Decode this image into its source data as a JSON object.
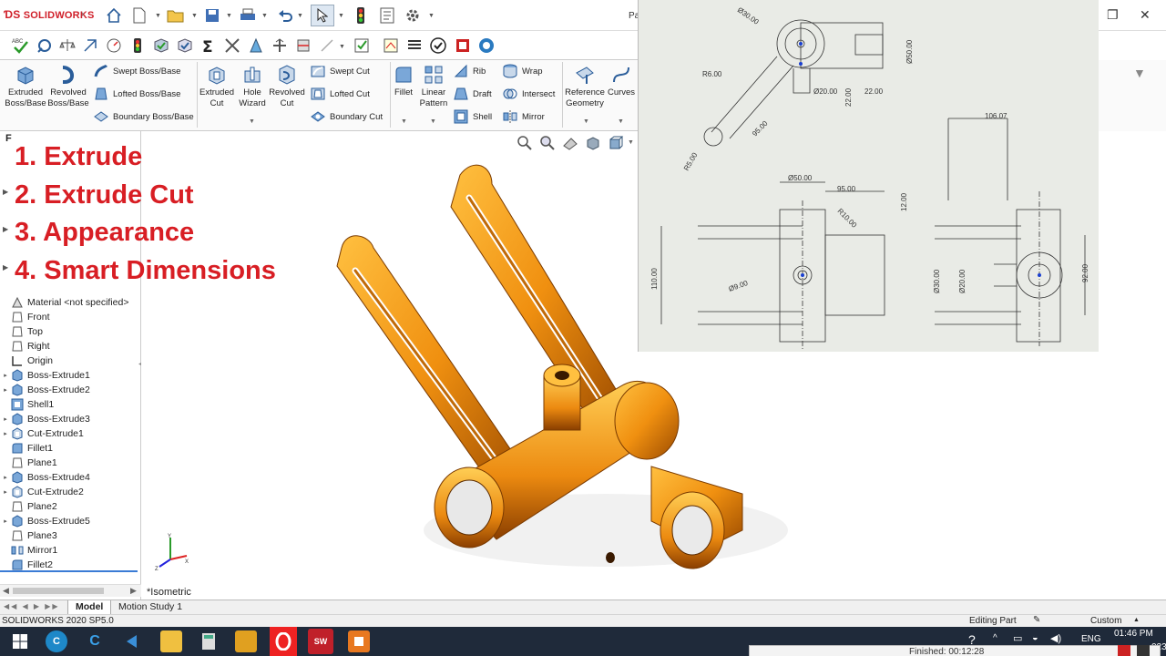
{
  "app": {
    "brand": "SOLIDWORKS",
    "doc_title_partial": "Pa",
    "version_status": "SOLIDWORKS 2020 SP5.0"
  },
  "ribbon": {
    "extruded_boss": "Extruded Boss/Base",
    "revolved_boss": "Revolved Boss/Base",
    "swept_boss": "Swept Boss/Base",
    "lofted_boss": "Lofted Boss/Base",
    "boundary_boss": "Boundary Boss/Base",
    "extruded_cut": "Extruded Cut",
    "hole_wizard": "Hole Wizard",
    "revolved_cut": "Revolved Cut",
    "swept_cut": "Swept Cut",
    "lofted_cut": "Lofted Cut",
    "boundary_cut": "Boundary Cut",
    "fillet": "Fillet",
    "linear_pattern": "Linear Pattern",
    "rib": "Rib",
    "wrap": "Wrap",
    "draft": "Draft",
    "intersect": "Intersect",
    "shell": "Shell",
    "mirror": "Mirror",
    "reference_geometry": "Reference Geometry",
    "curves": "Curves"
  },
  "overlay_steps": [
    "1. Extrude",
    "2. Extrude Cut",
    "3. Appearance",
    "4. Smart Dimensions"
  ],
  "tree": {
    "tab_letter": "F",
    "items": [
      {
        "label": "Material <not specified>",
        "expandable": false,
        "icon": "material-icon"
      },
      {
        "label": "Front",
        "expandable": false,
        "icon": "plane-icon"
      },
      {
        "label": "Top",
        "expandable": false,
        "icon": "plane-icon"
      },
      {
        "label": "Right",
        "expandable": false,
        "icon": "plane-icon"
      },
      {
        "label": "Origin",
        "expandable": false,
        "icon": "origin-icon"
      },
      {
        "label": "Boss-Extrude1",
        "expandable": true,
        "icon": "boss-extrude-icon"
      },
      {
        "label": "Boss-Extrude2",
        "expandable": true,
        "icon": "boss-extrude-icon"
      },
      {
        "label": "Shell1",
        "expandable": false,
        "icon": "shell-icon"
      },
      {
        "label": "Boss-Extrude3",
        "expandable": true,
        "icon": "boss-extrude-icon"
      },
      {
        "label": "Cut-Extrude1",
        "expandable": true,
        "icon": "cut-extrude-icon"
      },
      {
        "label": "Fillet1",
        "expandable": false,
        "icon": "fillet-icon"
      },
      {
        "label": "Plane1",
        "expandable": false,
        "icon": "plane-icon"
      },
      {
        "label": "Boss-Extrude4",
        "expandable": true,
        "icon": "boss-extrude-icon"
      },
      {
        "label": "Cut-Extrude2",
        "expandable": true,
        "icon": "cut-extrude-icon"
      },
      {
        "label": "Plane2",
        "expandable": false,
        "icon": "plane-icon"
      },
      {
        "label": "Boss-Extrude5",
        "expandable": true,
        "icon": "boss-extrude-icon"
      },
      {
        "label": "Plane3",
        "expandable": false,
        "icon": "plane-icon"
      },
      {
        "label": "Mirror1",
        "expandable": false,
        "icon": "mirror-icon"
      },
      {
        "label": "Fillet2",
        "expandable": false,
        "icon": "fillet-icon"
      }
    ]
  },
  "viewport": {
    "view_label": "*Isometric",
    "triad_x": "X",
    "triad_y": "Y",
    "triad_z": "Z"
  },
  "drawing": {
    "dims": {
      "d30": "Ø30.00",
      "d50a": "Ø50.00",
      "r6": "R6.00",
      "d20a": "Ø20.00",
      "v22": "22.00",
      "h22": "22.00",
      "l95": "95.00",
      "r5": "R5.00",
      "w106": "106.07",
      "d50b": "Ø50.00",
      "w95": "95.00",
      "r10": "R10.00",
      "h12": "12.00",
      "h110": "110.00",
      "d9": "Ø9.00",
      "d30b": "Ø30.00",
      "d20b": "Ø20.00",
      "h92": "92.00"
    }
  },
  "tabs": {
    "model": "Model",
    "motion": "Motion Study 1"
  },
  "status": {
    "mode": "Editing Part",
    "units": "Custom"
  },
  "taskbar": {
    "time": "01:46 PM",
    "lang": "ENG",
    "year_partial": "023",
    "finished": "Finished: 00:12:28"
  },
  "colors": {
    "part_orange": "#f0a018",
    "step_red": "#d81e24",
    "brand_red": "#d0202a"
  }
}
